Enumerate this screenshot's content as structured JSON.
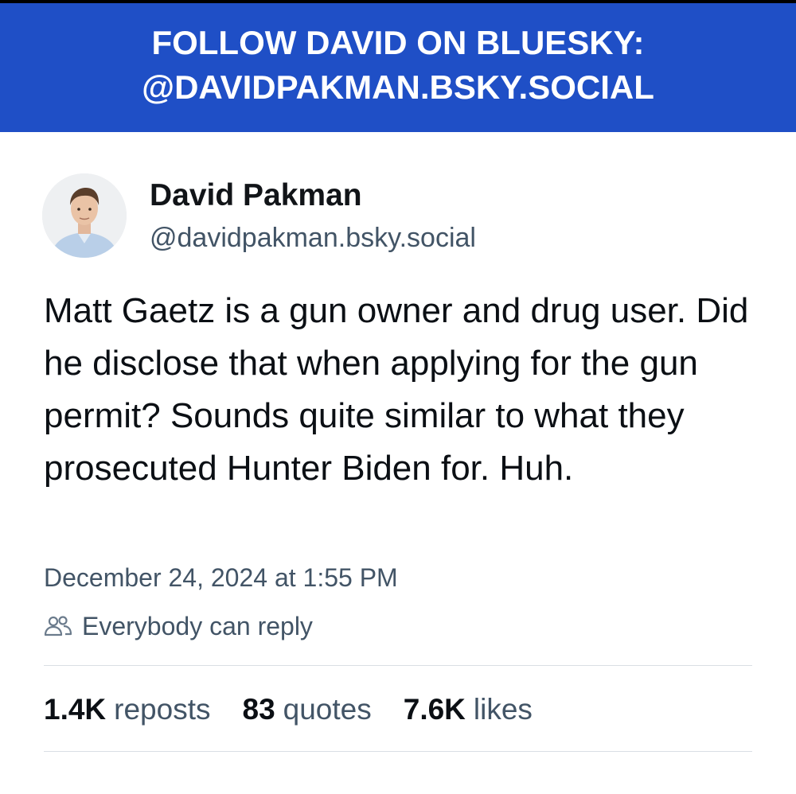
{
  "banner": {
    "line1": "FOLLOW DAVID ON BLUESKY:",
    "line2": "@DAVIDPAKMAN.BSKY.SOCIAL",
    "color": "#1f4fc6"
  },
  "author": {
    "display_name": "David Pakman",
    "handle": "@davidpakman.bsky.social"
  },
  "post": {
    "text": "Matt Gaetz is a gun owner and drug user. Did he disclose that when applying for the gun permit? Sounds quite similar to what they prosecuted Hunter Biden for. Huh.",
    "timestamp": "December 24, 2024 at 1:55 PM",
    "reply_setting_icon": "people-icon",
    "reply_setting": "Everybody can reply"
  },
  "stats": {
    "reposts_count": "1.4K",
    "reposts_label": "reposts",
    "quotes_count": "83",
    "quotes_label": "quotes",
    "likes_count": "7.6K",
    "likes_label": "likes"
  }
}
